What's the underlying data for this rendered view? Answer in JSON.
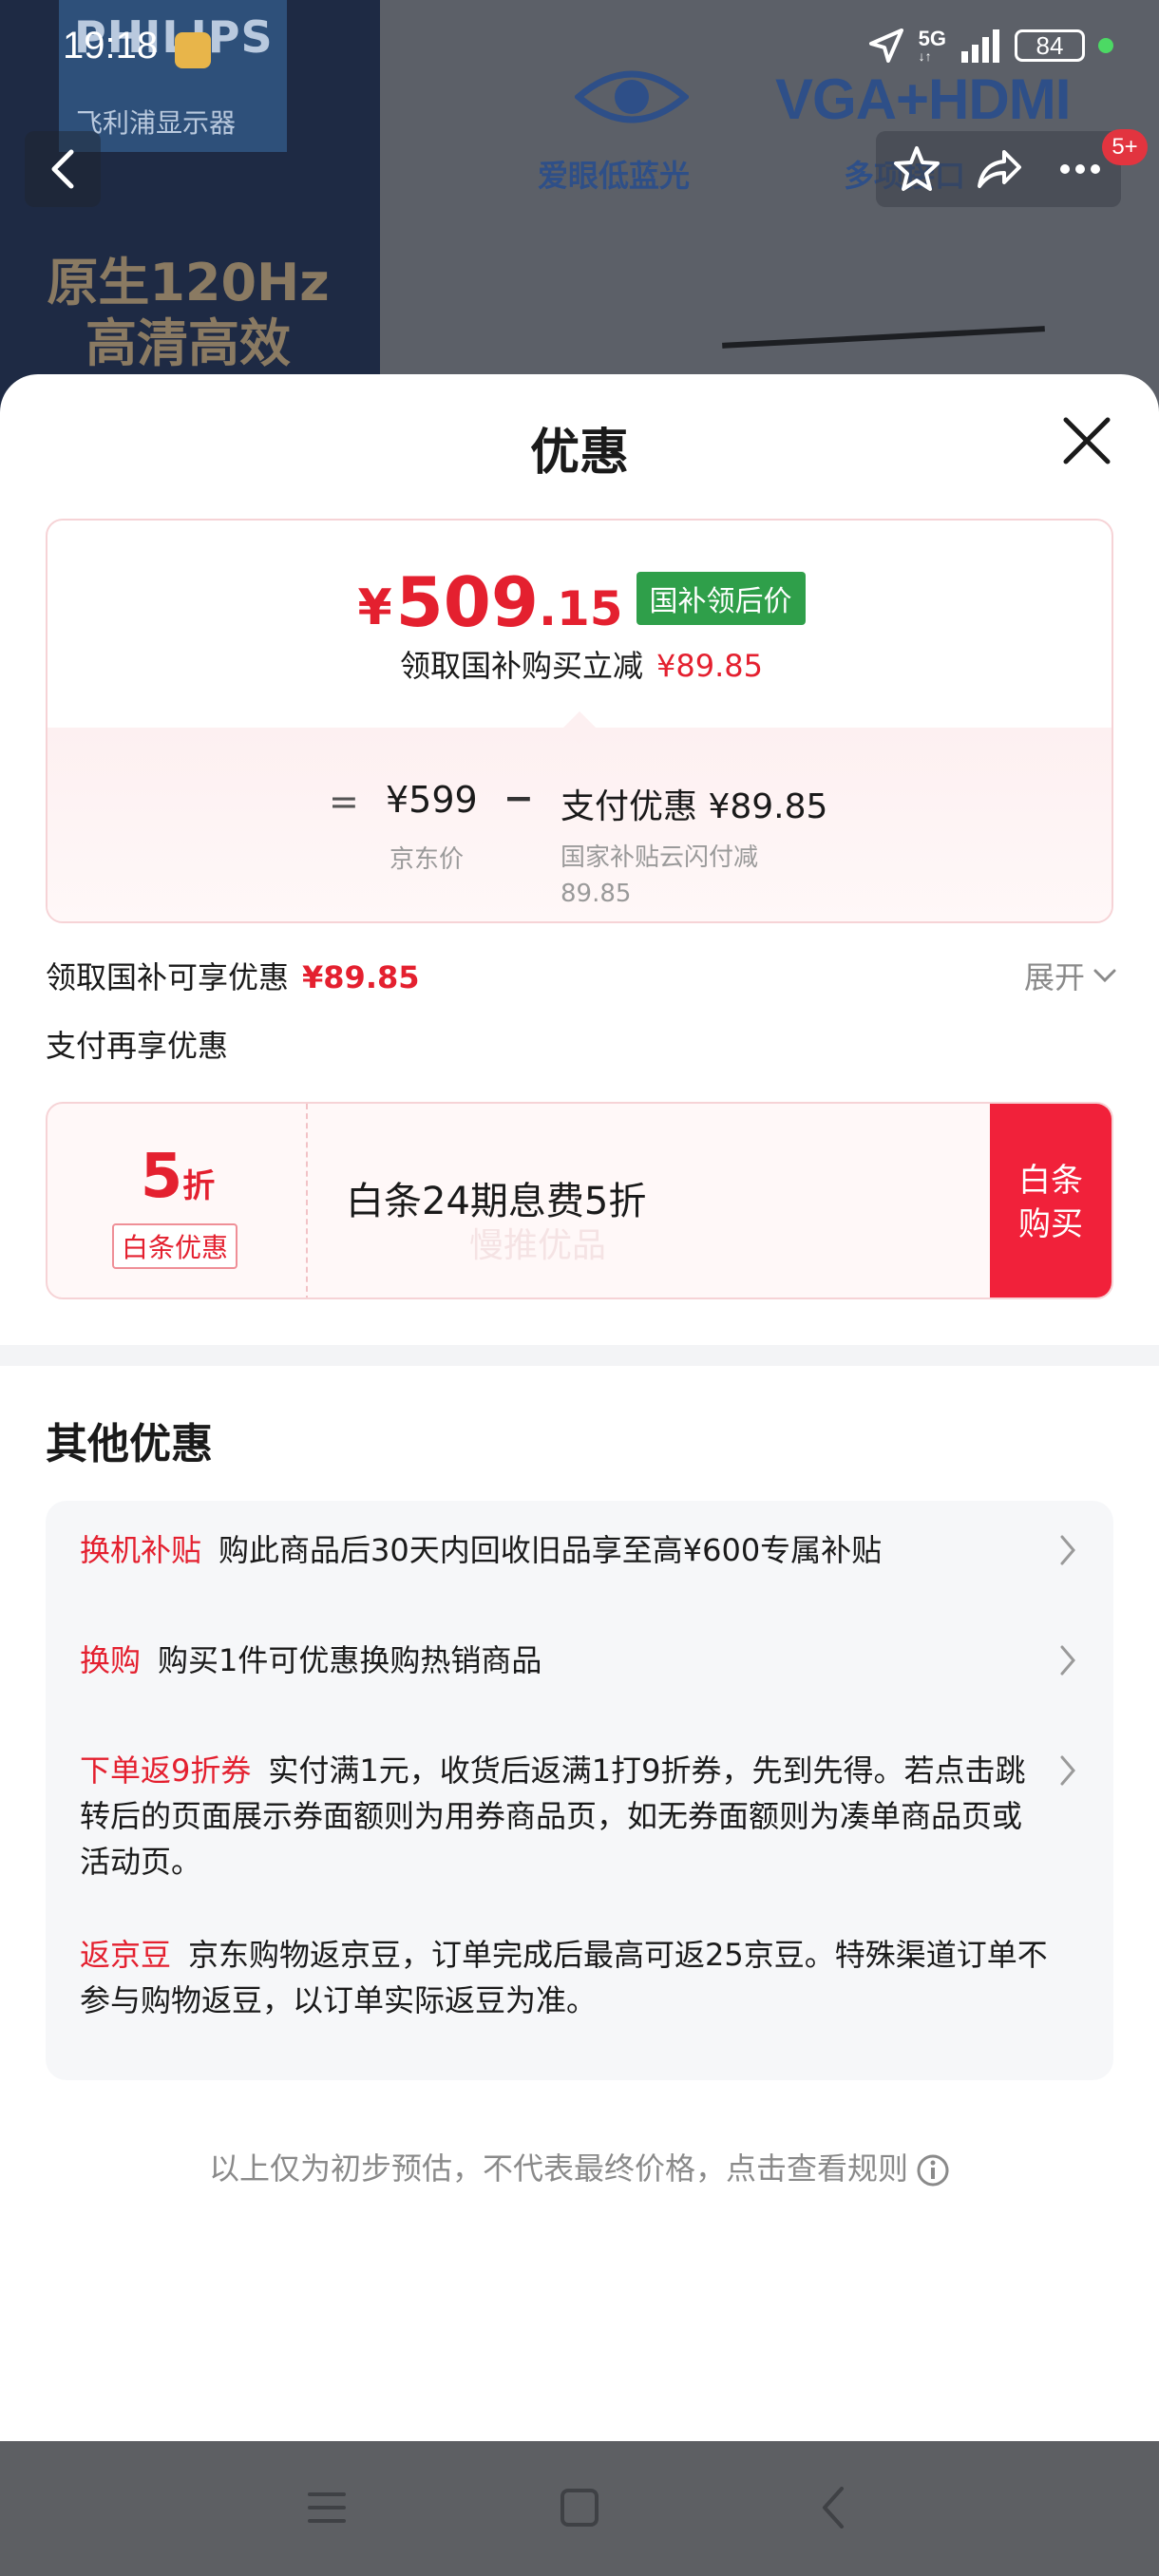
{
  "status_bar": {
    "time": "19:18",
    "network": "5G",
    "battery": "84"
  },
  "background": {
    "brand": "PHILIPS",
    "brand_sub": "飞利浦显示器",
    "promo": "原生120Hz 高清高效",
    "feature_1": "爱眼低蓝光",
    "feature_2_title": "VGA+HDMI",
    "feature_2": "多项接口",
    "badge": "5+"
  },
  "sheet": {
    "title": "优惠",
    "price": {
      "currency": "¥",
      "integer": "509",
      "decimal": ".15",
      "tag": "国补领后价"
    },
    "price_sub": {
      "text": "领取国补购买立减",
      "amount": "¥89.85"
    },
    "breakdown": {
      "eq": "=",
      "jd_price": "¥599",
      "jd_label": "京东价",
      "minus": "−",
      "pay_discount": "支付优惠 ¥89.85",
      "pay_label": "国家补贴云闪付减89.85"
    },
    "claim": {
      "text": "领取国补可享优惠",
      "amount": "¥89.85",
      "expand": "展开"
    },
    "pay_more": "支付再享优惠",
    "baitiao": {
      "discount_num": "5",
      "discount_unit": "折",
      "tag": "白条优惠",
      "text": "白条24期息费5折",
      "watermark": "慢推优品",
      "button": "白条购买"
    },
    "other_title": "其他优惠",
    "offers": [
      {
        "tag": "换机补贴",
        "text": "购此商品后30天内回收旧品享至高¥600专属补贴",
        "has_arrow": true
      },
      {
        "tag": "换购",
        "text": "购买1件可优惠换购热销商品",
        "has_arrow": true
      },
      {
        "tag": "下单返9折券",
        "text": "实付满1元，收货后返满1打9折券，先到先得。若点击跳转后的页面展示券面额则为用券商品页，如无券面额则为凑单商品页或活动页。",
        "has_arrow": true
      },
      {
        "tag": "返京豆",
        "text": "京东购物返京豆，订单完成后最高可返25京豆。特殊渠道订单不参与购物返豆，以订单实际返豆为准。",
        "has_arrow": false
      }
    ],
    "footer": "以上仅为初步预估，不代表最终价格，点击查看规则"
  },
  "colors": {
    "accent": "#e4202f",
    "tag_green": "#2f9f4a",
    "buy_button": "#f1213a"
  }
}
